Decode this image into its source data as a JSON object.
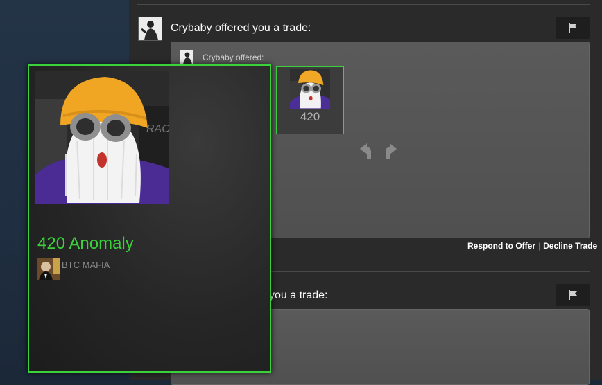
{
  "trade_offers": [
    {
      "headline": "Crybaby offered you a trade:",
      "offered_label": "Crybaby offered:",
      "item_count": "420",
      "actions": {
        "respond": "Respond to Offer",
        "separator": "|",
        "decline": "Decline Trade"
      }
    },
    {
      "headline_visible_fragment": "you a trade:"
    }
  ],
  "tooltip": {
    "item_name": "420 Anomaly",
    "owner_name": "BTC MAFIA",
    "border_color": "#3ad13a",
    "name_color": "#3ad13a"
  },
  "icons": [
    "flag-icon",
    "trade-arrow-left-icon",
    "trade-arrow-right-icon"
  ]
}
